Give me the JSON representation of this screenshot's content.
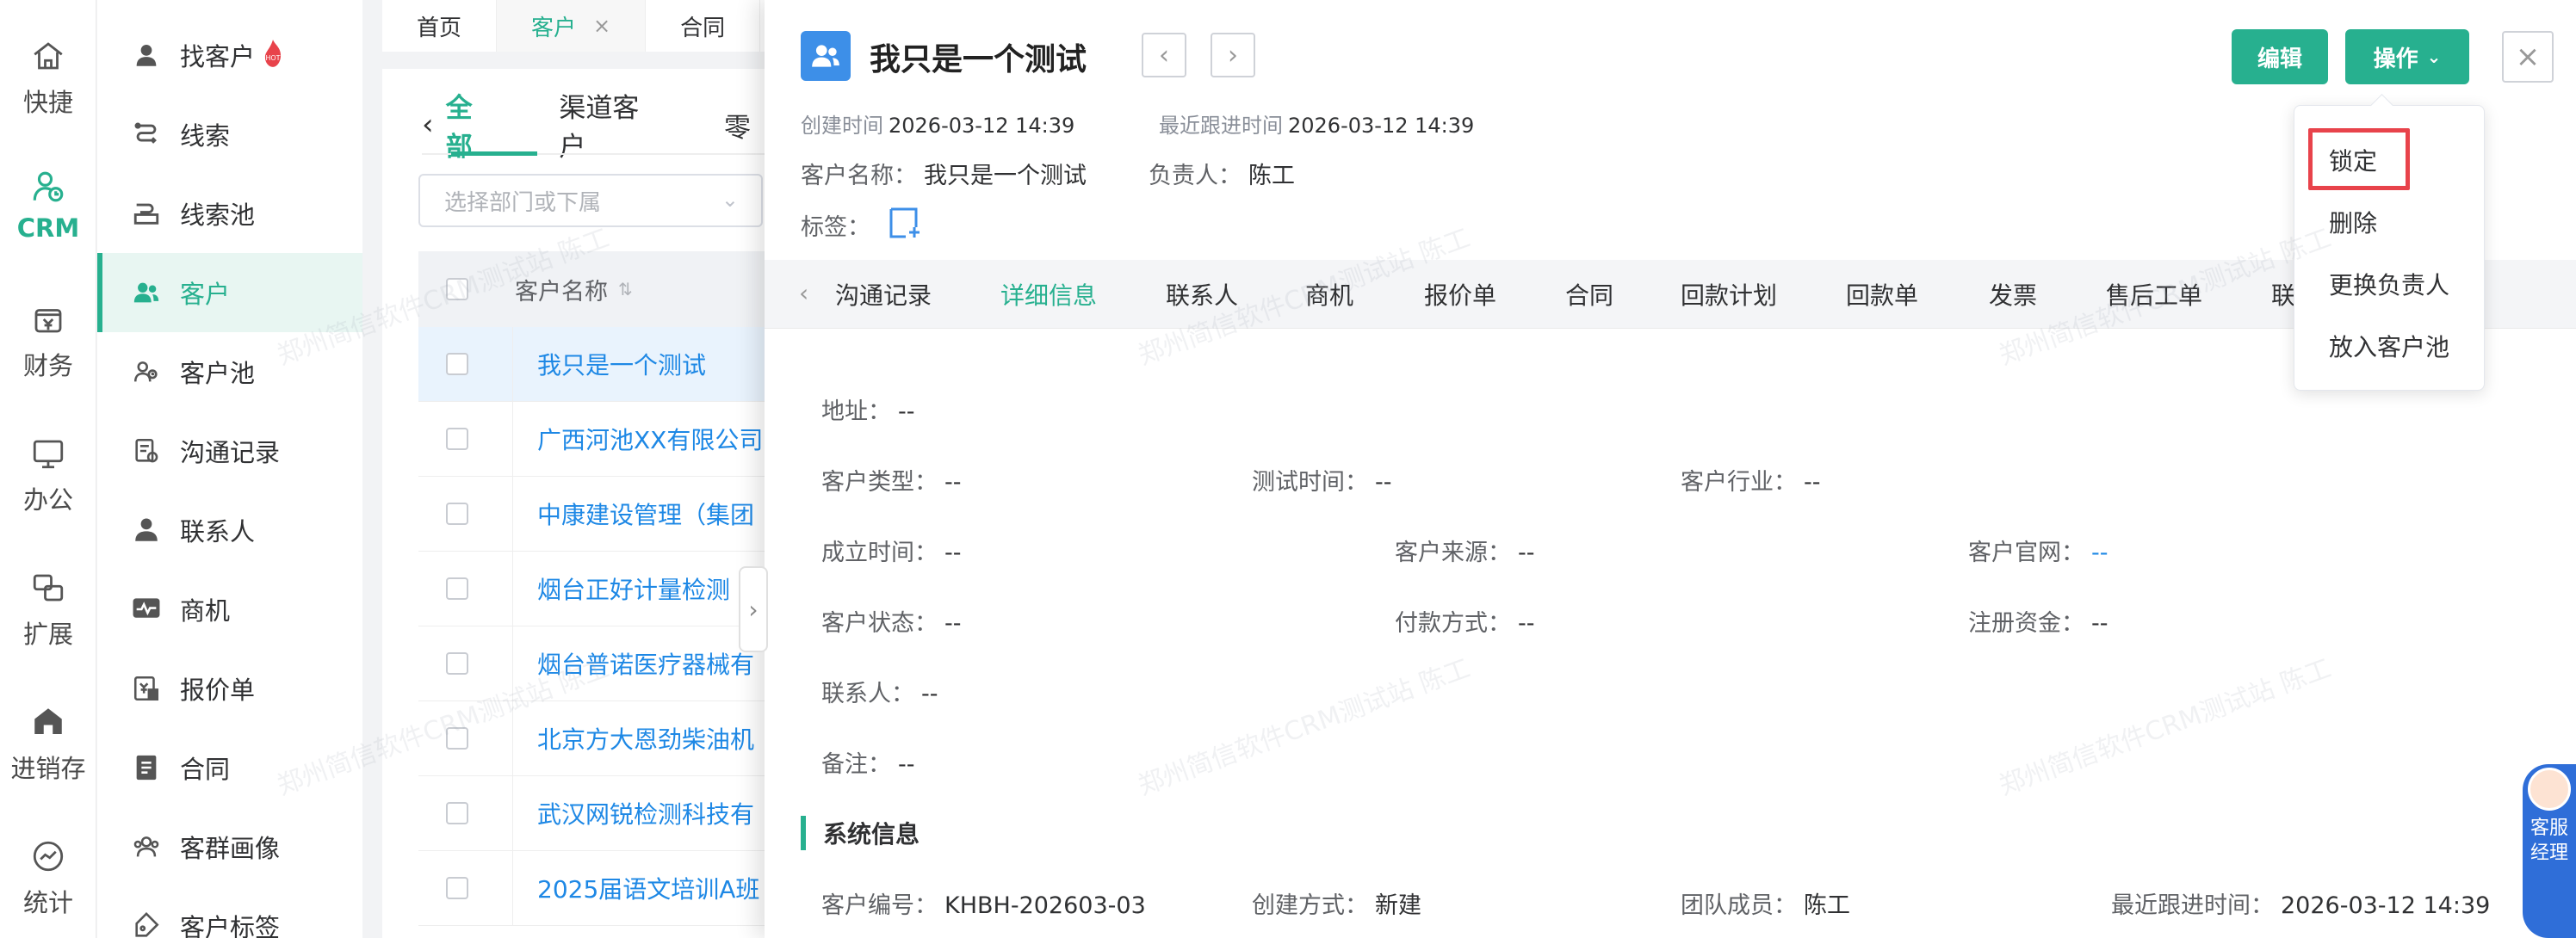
{
  "rail": [
    {
      "label": "快捷",
      "icon": "home-icon"
    },
    {
      "label": "CRM",
      "icon": "crm-icon",
      "active": true
    },
    {
      "label": "财务",
      "icon": "finance-icon"
    },
    {
      "label": "办公",
      "icon": "office-icon"
    },
    {
      "label": "扩展",
      "icon": "extend-icon"
    },
    {
      "label": "进销存",
      "icon": "inventory-icon"
    },
    {
      "label": "统计",
      "icon": "stats-icon"
    }
  ],
  "menu": [
    {
      "label": "找客户",
      "icon": "find-customer-icon",
      "hot": true
    },
    {
      "label": "线索",
      "icon": "lead-icon"
    },
    {
      "label": "线索池",
      "icon": "lead-pool-icon"
    },
    {
      "label": "客户",
      "icon": "customer-icon",
      "active": true
    },
    {
      "label": "客户池",
      "icon": "customer-pool-icon"
    },
    {
      "label": "沟通记录",
      "icon": "communication-icon"
    },
    {
      "label": "联系人",
      "icon": "contact-icon"
    },
    {
      "label": "商机",
      "icon": "opportunity-icon"
    },
    {
      "label": "报价单",
      "icon": "quote-icon"
    },
    {
      "label": "合同",
      "icon": "contract-icon"
    },
    {
      "label": "客群画像",
      "icon": "portrait-icon"
    },
    {
      "label": "客户标签",
      "icon": "tag-icon"
    }
  ],
  "hot_badge": "HOT",
  "top_tabs": [
    {
      "label": "首页"
    },
    {
      "label": "客户",
      "active": true,
      "closable": true
    },
    {
      "label": "合同"
    }
  ],
  "list": {
    "views": [
      "全部",
      "渠道客户",
      "零"
    ],
    "dept_placeholder": "选择部门或下属",
    "column": "客户名称",
    "rows": [
      "我只是一个测试",
      "广西河池XX有限公司",
      "中康建设管理（集团",
      "烟台正好计量检测",
      "烟台普诺医疗器械有",
      "北京方大恩劲柴油机",
      "武汉网锐检测科技有",
      "2025届语文培训A班"
    ]
  },
  "drawer": {
    "title": "我只是一个测试",
    "edit_label": "编辑",
    "ops_label": "操作",
    "created_label": "创建时间",
    "created_value": "2026-03-12 14:39",
    "followup_label": "最近跟进时间",
    "followup_value": "2026-03-12 14:39",
    "name_label": "客户名称：",
    "name_value": "我只是一个测试",
    "owner_label": "负责人：",
    "owner_value": "陈工",
    "tag_label": "标签：",
    "tabs": [
      "沟通记录",
      "详细信息",
      "联系人",
      "商机",
      "报价单",
      "合同",
      "回款计划",
      "回款单",
      "发票",
      "售后工单",
      "联"
    ],
    "active_tab": "详细信息",
    "fields": {
      "address": {
        "label": "地址：",
        "value": "--"
      },
      "type": {
        "label": "客户类型：",
        "value": "--"
      },
      "test_time": {
        "label": "测试时间：",
        "value": "--"
      },
      "industry": {
        "label": "客户行业：",
        "value": "--"
      },
      "founded": {
        "label": "成立时间：",
        "value": "--"
      },
      "source": {
        "label": "客户来源：",
        "value": "--"
      },
      "website": {
        "label": "客户官网：",
        "value": "--"
      },
      "status": {
        "label": "客户状态：",
        "value": "--"
      },
      "payment": {
        "label": "付款方式：",
        "value": "--"
      },
      "capital": {
        "label": "注册资金：",
        "value": "--"
      },
      "contact": {
        "label": "联系人：",
        "value": "--"
      },
      "remark": {
        "label": "备注：",
        "value": "--"
      }
    },
    "system_title": "系统信息",
    "system": {
      "code": {
        "label": "客户编号：",
        "value": "KHBH-202603-03"
      },
      "method": {
        "label": "创建方式：",
        "value": "新建"
      },
      "team": {
        "label": "团队成员：",
        "value": "陈工"
      },
      "last_follow": {
        "label": "最近跟进时间：",
        "value": "2026-03-12 14:39"
      }
    }
  },
  "dropdown": [
    "锁定",
    "删除",
    "更换负责人",
    "放入客户池"
  ],
  "service": "客服经理",
  "watermark": "郑州简信软件CRM测试站 陈工",
  "colors": {
    "accent": "#27b08f",
    "link": "#1e88e5",
    "highlight": "#e8434b"
  }
}
